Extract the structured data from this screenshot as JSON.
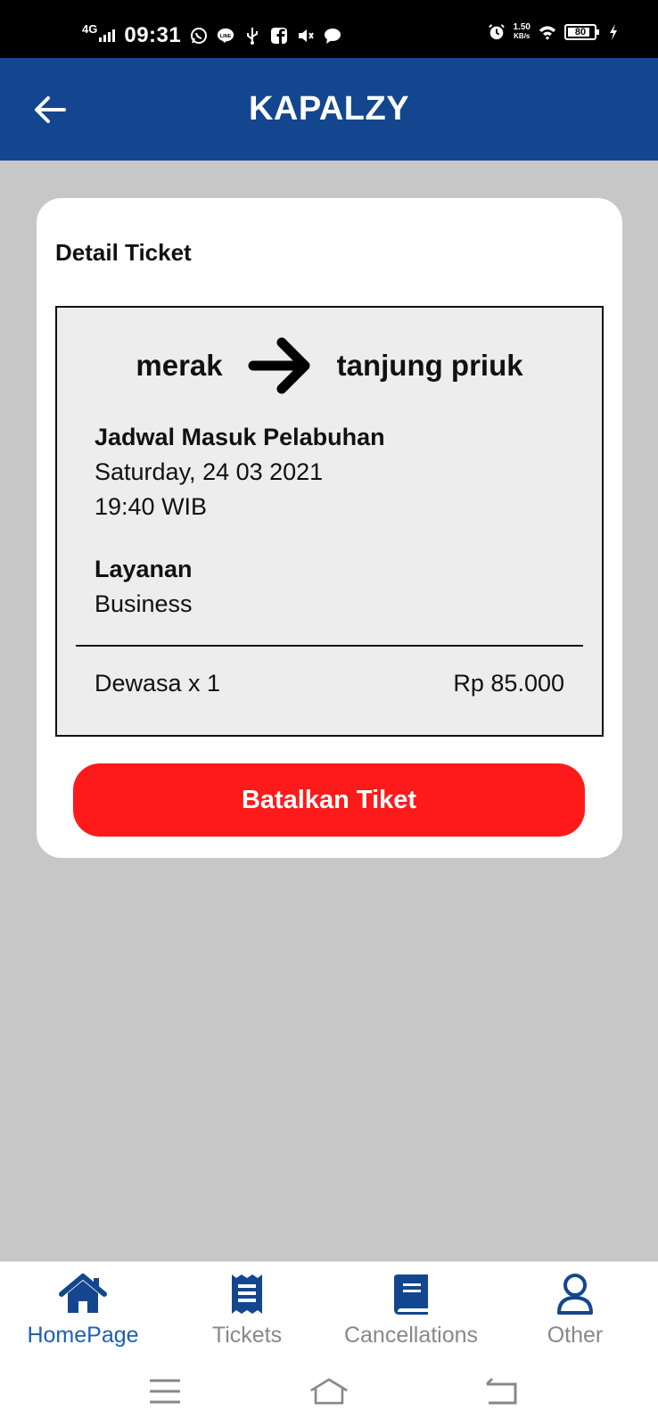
{
  "status_bar": {
    "network": "4G",
    "time": "09:31",
    "speed_value": "1.50",
    "speed_unit": "KB/s",
    "battery": "80"
  },
  "app_bar": {
    "title": "KAPALZY",
    "back_icon": "arrow-left-icon"
  },
  "card": {
    "title": "Detail Ticket",
    "route": {
      "from": "merak",
      "to": "tanjung priuk",
      "arrow_icon": "arrow-right-icon"
    },
    "schedule": {
      "label": "Jadwal Masuk Pelabuhan",
      "date": "Saturday, 24 03 2021",
      "time": "19:40 WIB"
    },
    "service": {
      "label": "Layanan",
      "value": "Business"
    },
    "passenger": "Dewasa x 1",
    "price": "Rp 85.000",
    "cancel_button": "Batalkan Tiket"
  },
  "bottom_nav": {
    "items": [
      {
        "label": "HomePage",
        "icon": "home-icon",
        "active": true
      },
      {
        "label": "Tickets",
        "icon": "receipt-icon",
        "active": false
      },
      {
        "label": "Cancellations",
        "icon": "book-icon",
        "active": false
      },
      {
        "label": "Other",
        "icon": "user-icon",
        "active": false
      }
    ]
  },
  "colors": {
    "app_bar": "#13468e",
    "cancel_button": "#fe1a1a",
    "nav_active": "#1d5fb8",
    "nav_icon": "#13468e",
    "background": "#c8c7c8"
  }
}
